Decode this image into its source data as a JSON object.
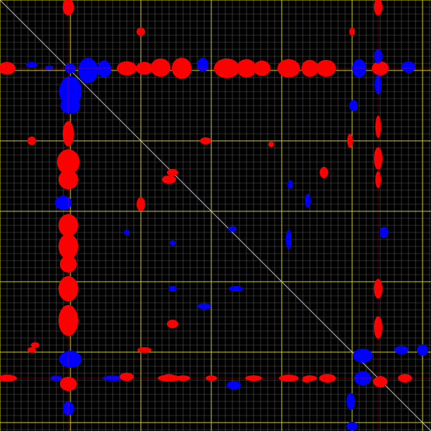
{
  "view": {
    "type": "2d-nmr-contour-spectrum",
    "background_color": "#000000",
    "minor_grid_color": "#5a5a5a",
    "major_grid_color": "#d8d800",
    "diagonal_color": "#bdbdbd",
    "positive_peak_color": "#ff0000",
    "negative_peak_color": "#0000ff"
  }
}
